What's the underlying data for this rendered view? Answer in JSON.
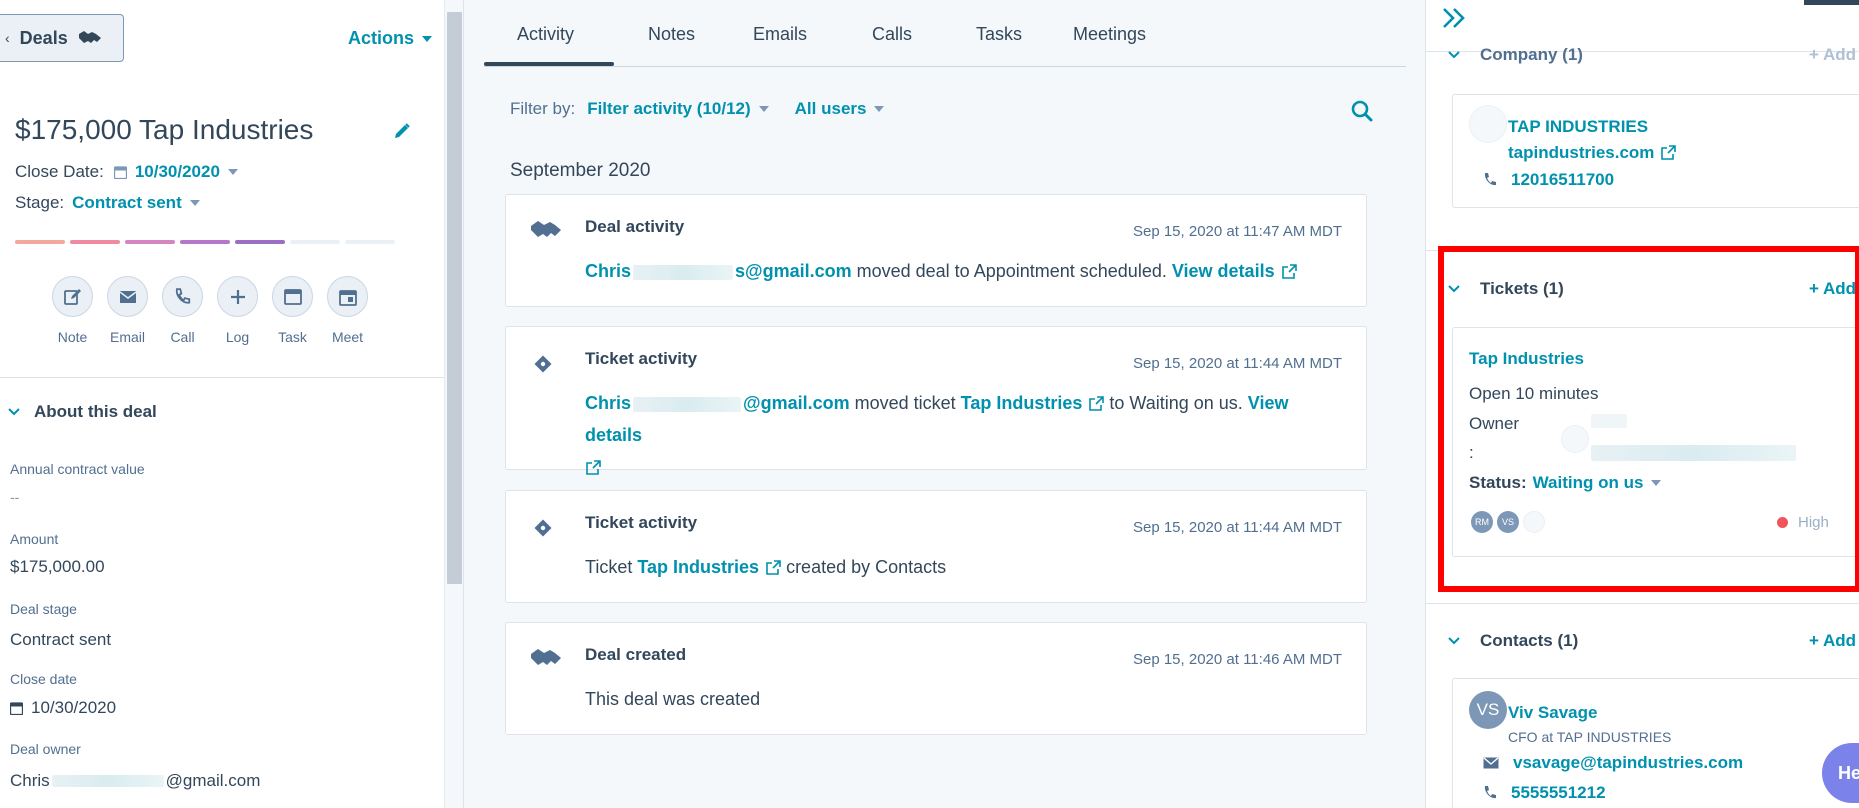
{
  "left": {
    "back_label": "Deals",
    "actions_label": "Actions",
    "deal_title": "$175,000 Tap Industries",
    "close_date_label": "Close Date:",
    "close_date_value": "10/30/2020",
    "stage_label": "Stage:",
    "stage_value": "Contract sent",
    "pipeline_colors": [
      "#f2a89b",
      "#f08aa0",
      "#d585c0",
      "#b577c8",
      "#9b6fc4",
      "#eaf0f6",
      "#eaf0f6"
    ],
    "quick_actions": [
      {
        "label": "Note",
        "icon": "note-icon"
      },
      {
        "label": "Email",
        "icon": "email-icon"
      },
      {
        "label": "Call",
        "icon": "phone-icon"
      },
      {
        "label": "Log",
        "icon": "plus-icon"
      },
      {
        "label": "Task",
        "icon": "task-icon"
      },
      {
        "label": "Meet",
        "icon": "calendar-icon"
      }
    ],
    "about_heading": "About this deal",
    "properties": [
      {
        "label": "Annual contract value",
        "value": "--"
      },
      {
        "label": "Amount",
        "value": "$175,000.00"
      },
      {
        "label": "Deal stage",
        "value": "Contract sent"
      },
      {
        "label": "Close date",
        "value": "10/30/2020"
      },
      {
        "label": "Deal owner",
        "value_prefix": "Chris",
        "value_suffix": "@gmail.com"
      }
    ]
  },
  "middle": {
    "tabs": [
      "Activity",
      "Notes",
      "Emails",
      "Calls",
      "Tasks",
      "Meetings"
    ],
    "active_tab": "Activity",
    "filter_by_label": "Filter by:",
    "filter_activity": "Filter activity (10/12)",
    "filter_users": "All users",
    "month": "September 2020",
    "cards": [
      {
        "title": "Deal activity",
        "time": "Sep 15, 2020 at 11:47 AM MDT",
        "user_prefix": "Chris",
        "user_suffix": "s@gmail.com",
        "text": "moved deal to Appointment scheduled.",
        "view_details": "View details"
      },
      {
        "title": "Ticket activity",
        "time": "Sep 15, 2020 at 11:44 AM MDT",
        "user_prefix": "Chris",
        "user_suffix": "@gmail.com",
        "text1": "moved ticket",
        "ticket_link": "Tap Industries",
        "text2": "to Waiting on us.",
        "view_details": "View details"
      },
      {
        "title": "Ticket activity",
        "time": "Sep 15, 2020 at 11:44 AM MDT",
        "text1": "Ticket",
        "ticket_link": "Tap Industries",
        "text2": "created by Contacts"
      },
      {
        "title": "Deal created",
        "time": "Sep 15, 2020 at 11:46 AM MDT",
        "text": "This deal was created"
      }
    ]
  },
  "right": {
    "company": {
      "heading": "Company (1)",
      "add_label": "+ Add",
      "name": "TAP INDUSTRIES",
      "domain": "tapindustries.com",
      "phone": "12016511700"
    },
    "tickets": {
      "heading": "Tickets (1)",
      "add_label": "+ Add",
      "name": "Tap Industries",
      "open_time": "Open 10 minutes",
      "owner_label": "Owner",
      "owner_colon": ":",
      "status_label": "Status:",
      "status_value": "Waiting on us",
      "avatars": [
        "RM",
        "VS"
      ],
      "priority": "High",
      "priority_color": "#f2545b"
    },
    "contacts": {
      "heading": "Contacts (1)",
      "add_label": "+ Add",
      "initials": "VS",
      "name": "Viv Savage",
      "title": "CFO at TAP INDUSTRIES",
      "email": "vsavage@tapindustries.com",
      "phone": "5555551212"
    },
    "help_label": "He"
  }
}
